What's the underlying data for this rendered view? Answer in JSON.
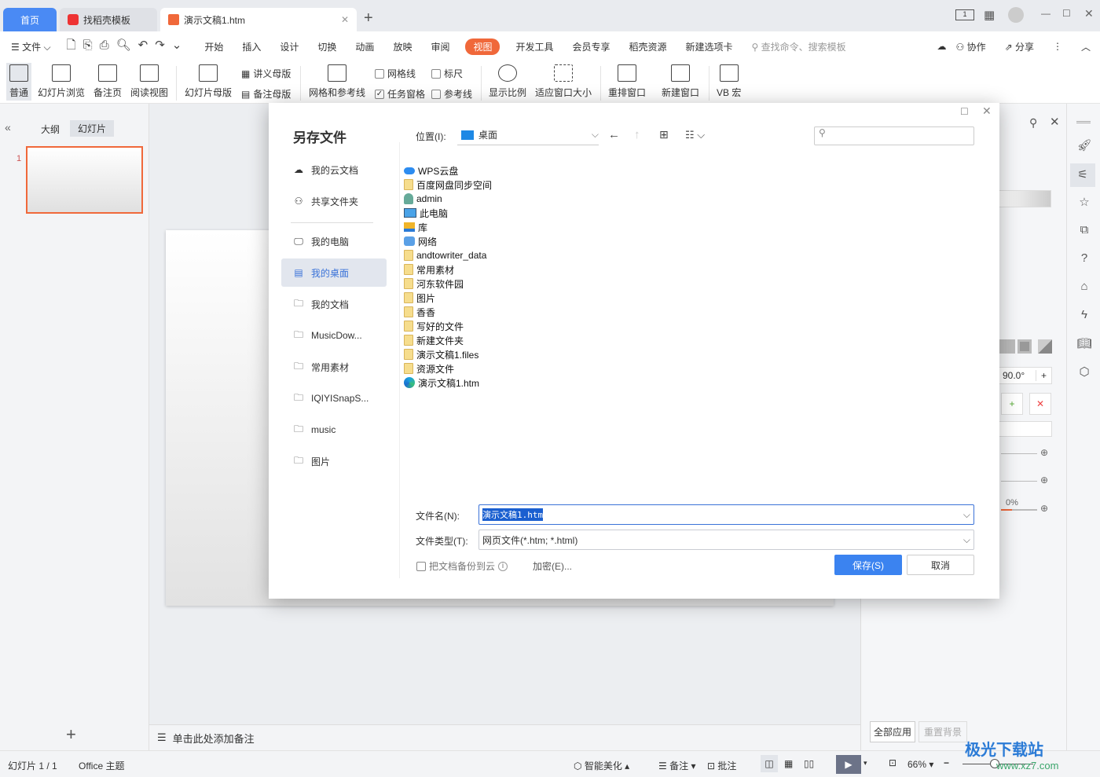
{
  "tabs": [
    {
      "label": "首页",
      "active": false
    },
    {
      "label": "找稻壳模板"
    },
    {
      "label": "演示文稿1.htm",
      "active": true
    }
  ],
  "menu": {
    "file": "文件",
    "items": [
      "开始",
      "插入",
      "设计",
      "切换",
      "动画",
      "放映",
      "审阅",
      "视图",
      "开发工具",
      "会员专享",
      "稻壳资源",
      "新建选项卡"
    ],
    "active": "视图",
    "search": "查找命令、搜索模板",
    "collab": "协作",
    "share": "分享"
  },
  "ribbon": {
    "normal": "普通",
    "slide_browse": "幻灯片浏览",
    "notes_page": "备注页",
    "reading": "阅读视图",
    "slide_master": "幻灯片母版",
    "handout_master": "讲义母版",
    "notes_master": "备注母版",
    "grid_guides": "网格和参考线",
    "gridlines": "网格线",
    "ruler": "标尺",
    "task_pane": "任务窗格",
    "guides": "参考线",
    "zoom": "显示比例",
    "fit": "适应窗口大小",
    "arrange": "重排窗口",
    "new_window": "新建窗口",
    "vb": "VB 宏"
  },
  "left_panel": {
    "outline": "大纲",
    "slides": "幻灯片",
    "slide_num": "1"
  },
  "notes_placeholder": "单击此处添加备注",
  "right_panel": {
    "angle": "90.0°",
    "percent": "0%",
    "apply_all": "全部应用",
    "reset_bg": "重置背景"
  },
  "status": {
    "slide": "幻灯片 1 / 1",
    "theme": "Office 主题",
    "beautify": "智能美化",
    "notes": "备注",
    "comment": "批注",
    "zoom": "66%"
  },
  "dialog": {
    "title": "另存文件",
    "location_label": "位置(I):",
    "location_value": "桌面",
    "search_placeholder": "",
    "sidebar": [
      {
        "label": "我的云文档",
        "icon": "cloud-icon"
      },
      {
        "label": "共享文件夹",
        "icon": "share-folder-icon"
      },
      {
        "label": "我的电脑",
        "icon": "computer-icon"
      },
      {
        "label": "我的桌面",
        "icon": "desktop-icon",
        "selected": true
      },
      {
        "label": "我的文档",
        "icon": "folder-icon"
      },
      {
        "label": "MusicDow...",
        "icon": "folder-icon"
      },
      {
        "label": "常用素材",
        "icon": "folder-icon"
      },
      {
        "label": "IQIYISnapS...",
        "icon": "folder-icon"
      },
      {
        "label": "music",
        "icon": "folder-icon"
      },
      {
        "label": "图片",
        "icon": "folder-icon"
      }
    ],
    "files": [
      {
        "name": "WPS云盘",
        "icon": "wps-cloud-icon"
      },
      {
        "name": "百度网盘同步空间",
        "icon": "folder-icon"
      },
      {
        "name": "admin",
        "icon": "user-icon"
      },
      {
        "name": "此电脑",
        "icon": "computer-icon"
      },
      {
        "name": "库",
        "icon": "library-icon"
      },
      {
        "name": "网络",
        "icon": "network-icon"
      },
      {
        "name": "andtowriter_data",
        "icon": "folder-icon"
      },
      {
        "name": "常用素材",
        "icon": "folder-icon"
      },
      {
        "name": "河东软件园",
        "icon": "folder-icon"
      },
      {
        "name": "图片",
        "icon": "folder-icon"
      },
      {
        "name": "香香",
        "icon": "folder-icon"
      },
      {
        "name": "写好的文件",
        "icon": "folder-icon"
      },
      {
        "name": "新建文件夹",
        "icon": "folder-icon"
      },
      {
        "name": "演示文稿1.files",
        "icon": "folder-icon"
      },
      {
        "name": "资源文件",
        "icon": "folder-icon"
      },
      {
        "name": "演示文稿1.htm",
        "icon": "edge-icon"
      }
    ],
    "filename_label": "文件名(N):",
    "filename_value": "演示文稿1.htm",
    "filetype_label": "文件类型(T):",
    "filetype_value": "网页文件(*.htm; *.html)",
    "backup_label": "把文档备份到云",
    "encrypt": "加密(E)...",
    "save": "保存(S)",
    "cancel": "取消"
  },
  "watermark": {
    "name": "极光下载站",
    "url": "www.xz7.com"
  }
}
